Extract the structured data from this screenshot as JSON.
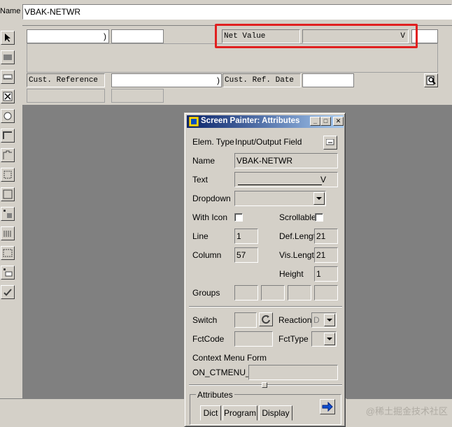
{
  "top": {
    "name_label": "Name",
    "name_value": "VBAK-NETWR"
  },
  "screen": {
    "net_value_label": "Net Value",
    "net_value_field": "V",
    "cust_ref_label": "Cust. Reference",
    "cust_ref_date_label": "Cust. Ref. Date",
    "paren_field": ")",
    "cust_ref_field_end": ")"
  },
  "dialog": {
    "title": "Screen Painter: Attributes",
    "elem_type_label": "Elem. Type",
    "elem_type_value": "Input/Output Field",
    "name_label": "Name",
    "name_value": "VBAK-NETWR",
    "text_label": "Text",
    "text_value": "V",
    "dropdown_label": "Dropdown",
    "with_icon_label": "With Icon",
    "scrollable_label": "Scrollable",
    "line_label": "Line",
    "line_value": "1",
    "def_length_label": "Def.Lengt",
    "def_length_value": "21",
    "column_label": "Column",
    "column_value": "57",
    "vis_length_label": "Vis.Length",
    "vis_length_value": "21",
    "height_label": "Height",
    "height_value": "1",
    "groups_label": "Groups",
    "switch_label": "Switch",
    "reaction_label": "Reaction",
    "reaction_value": "D",
    "fctcode_label": "FctCode",
    "fcttype_label": "FctType",
    "context_menu_label": "Context Menu Form",
    "context_menu_prefix": "ON_CTMENU_",
    "attributes_label": "Attributes",
    "tabs": [
      "Dict",
      "Program",
      "Display"
    ]
  },
  "watermark": "@稀土掘金技术社区"
}
